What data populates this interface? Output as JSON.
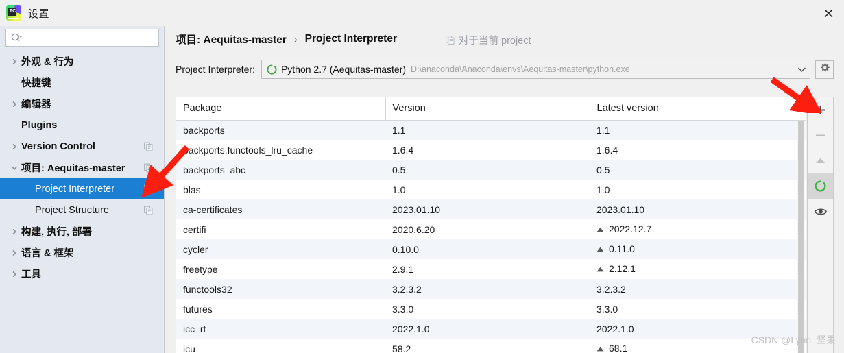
{
  "window": {
    "title": "设置",
    "logo_text": "PC",
    "close_label": "✕"
  },
  "sidebar": {
    "search": {
      "value": "",
      "placeholder": ""
    },
    "items": [
      {
        "label": "外观 & 行为",
        "expandable": true,
        "expanded": false,
        "indent": false,
        "selected": false,
        "copy_icon": false
      },
      {
        "label": "快捷键",
        "expandable": false,
        "expanded": false,
        "indent": false,
        "selected": false,
        "copy_icon": false
      },
      {
        "label": "编辑器",
        "expandable": true,
        "expanded": false,
        "indent": false,
        "selected": false,
        "copy_icon": false
      },
      {
        "label": "Plugins",
        "expandable": false,
        "expanded": false,
        "indent": false,
        "selected": false,
        "copy_icon": false
      },
      {
        "label": "Version Control",
        "expandable": true,
        "expanded": false,
        "indent": false,
        "selected": false,
        "copy_icon": true
      },
      {
        "label": "项目: Aequitas-master",
        "expandable": true,
        "expanded": true,
        "indent": false,
        "selected": false,
        "copy_icon": true
      },
      {
        "label": "Project Interpreter",
        "expandable": false,
        "expanded": false,
        "indent": true,
        "selected": true,
        "copy_icon": true
      },
      {
        "label": "Project Structure",
        "expandable": false,
        "expanded": false,
        "indent": true,
        "selected": false,
        "copy_icon": true
      },
      {
        "label": "构建, 执行, 部署",
        "expandable": true,
        "expanded": false,
        "indent": false,
        "selected": false,
        "copy_icon": false
      },
      {
        "label": "语言 & 框架",
        "expandable": true,
        "expanded": false,
        "indent": false,
        "selected": false,
        "copy_icon": false
      },
      {
        "label": "工具",
        "expandable": true,
        "expanded": false,
        "indent": false,
        "selected": false,
        "copy_icon": false
      }
    ]
  },
  "content": {
    "breadcrumb": {
      "parent": "项目: Aequitas-master",
      "separator": "›",
      "current": "Project Interpreter"
    },
    "scope_note": "对于当前 project",
    "interpreter": {
      "label": "Project Interpreter:",
      "name": "Python 2.7 (Aequitas-master)",
      "path": "D:\\anaconda\\Anaconda\\envs\\Aequitas-master\\python.exe",
      "dropdown_arrow": "⌄"
    },
    "table": {
      "columns": [
        "Package",
        "Version",
        "Latest version"
      ],
      "rows": [
        {
          "package": "backports",
          "version": "1.1",
          "latest": "1.1",
          "upgradable": false
        },
        {
          "package": "backports.functools_lru_cache",
          "version": "1.6.4",
          "latest": "1.6.4",
          "upgradable": false
        },
        {
          "package": "backports_abc",
          "version": "0.5",
          "latest": "0.5",
          "upgradable": false
        },
        {
          "package": "blas",
          "version": "1.0",
          "latest": "1.0",
          "upgradable": false
        },
        {
          "package": "ca-certificates",
          "version": "2023.01.10",
          "latest": "2023.01.10",
          "upgradable": false
        },
        {
          "package": "certifi",
          "version": "2020.6.20",
          "latest": "2022.12.7",
          "upgradable": true
        },
        {
          "package": "cycler",
          "version": "0.10.0",
          "latest": "0.11.0",
          "upgradable": true
        },
        {
          "package": "freetype",
          "version": "2.9.1",
          "latest": "2.12.1",
          "upgradable": true
        },
        {
          "package": "functools32",
          "version": "3.2.3.2",
          "latest": "3.2.3.2",
          "upgradable": false
        },
        {
          "package": "futures",
          "version": "3.3.0",
          "latest": "3.3.0",
          "upgradable": false
        },
        {
          "package": "icc_rt",
          "version": "2022.1.0",
          "latest": "2022.1.0",
          "upgradable": false
        },
        {
          "package": "icu",
          "version": "58.2",
          "latest": "68.1",
          "upgradable": true
        }
      ]
    },
    "toolbar": {
      "add": "+",
      "remove": "−",
      "upgrade": "▲",
      "refresh": "refresh",
      "show_early": "eye"
    }
  },
  "annotations": {
    "arrow_color": "#fc1f10",
    "watermark": "CSDN @Lynn_坚果"
  },
  "colors": {
    "selection": "#1b7fd3",
    "sidebar_bg": "#e4e9ef",
    "row_alt": "#f2f5f9",
    "python_green": "#4aa745",
    "accent_red": "#fc1f10"
  }
}
